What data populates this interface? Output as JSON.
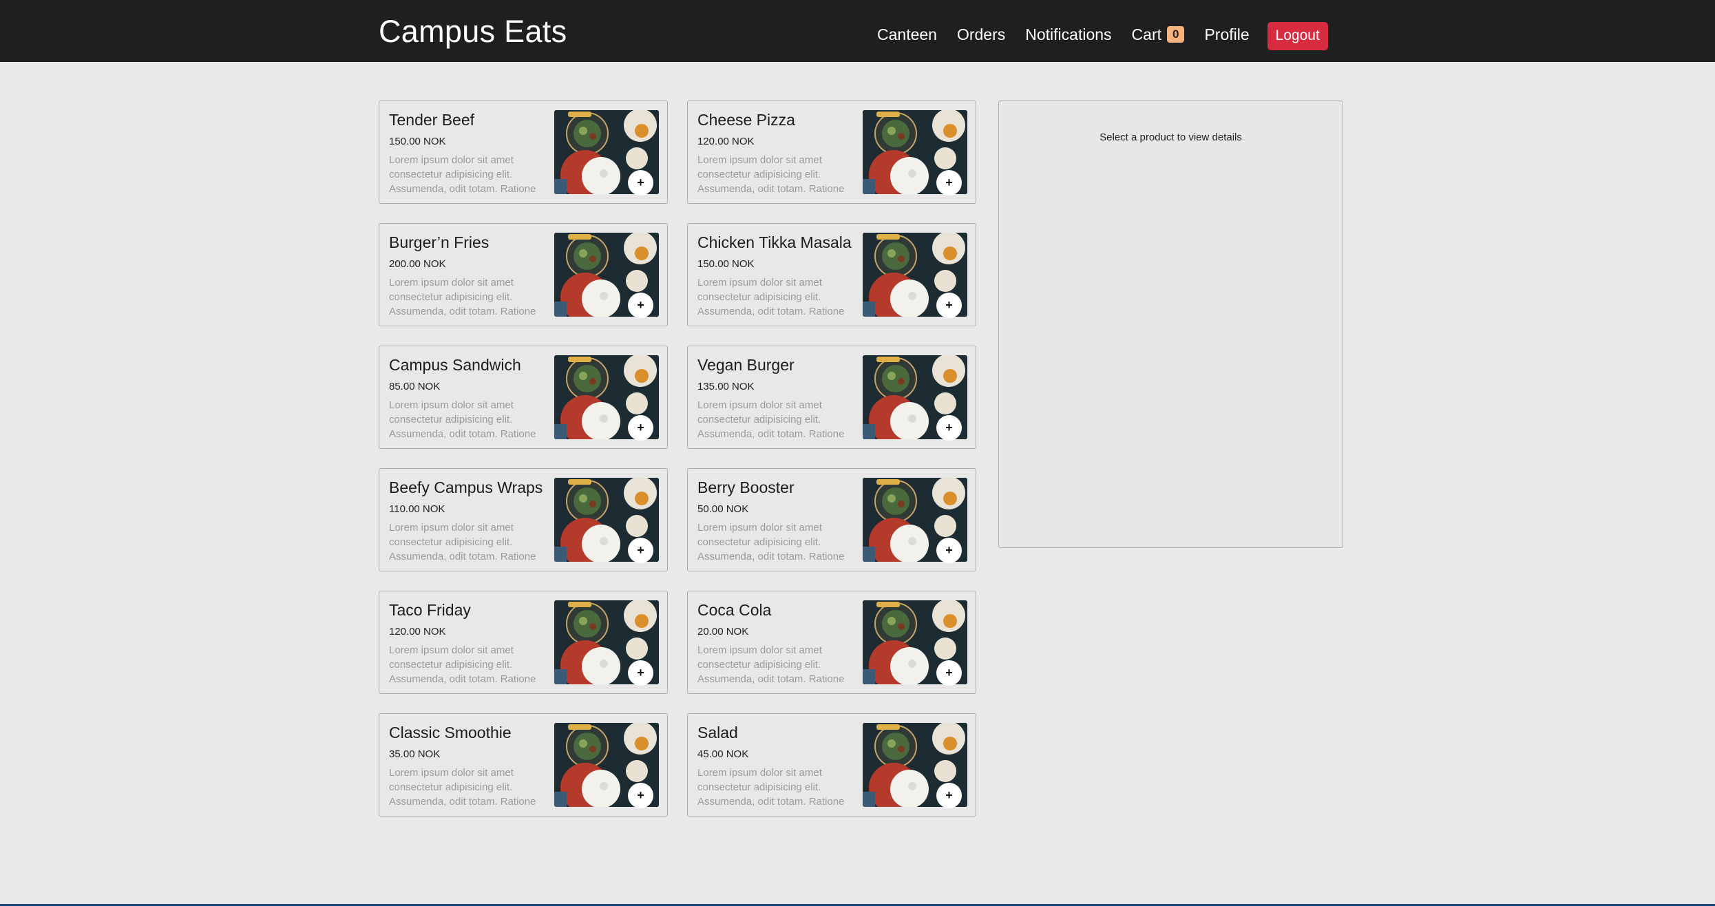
{
  "app": {
    "title": "Campus Eats"
  },
  "nav": {
    "links": [
      "Canteen",
      "Orders",
      "Notifications",
      "Cart",
      "Profile"
    ],
    "cart_count": "0",
    "logout_label": "Logout"
  },
  "products": [
    {
      "name": "Tender Beef",
      "price": "150.00 NOK",
      "description": "Lorem ipsum dolor sit amet consectetur adipisicing elit. Assumenda, odit totam. Ratione",
      "add_label": "+"
    },
    {
      "name": "Cheese Pizza",
      "price": "120.00 NOK",
      "description": "Lorem ipsum dolor sit amet consectetur adipisicing elit. Assumenda, odit totam. Ratione",
      "add_label": "+"
    },
    {
      "name": "Burger’n Fries",
      "price": "200.00 NOK",
      "description": "Lorem ipsum dolor sit amet consectetur adipisicing elit. Assumenda, odit totam. Ratione",
      "add_label": "+"
    },
    {
      "name": "Chicken Tikka Masala",
      "price": "150.00 NOK",
      "description": "Lorem ipsum dolor sit amet consectetur adipisicing elit. Assumenda, odit totam. Ratione",
      "add_label": "+"
    },
    {
      "name": "Campus Sandwich",
      "price": "85.00 NOK",
      "description": "Lorem ipsum dolor sit amet consectetur adipisicing elit. Assumenda, odit totam. Ratione",
      "add_label": "+"
    },
    {
      "name": "Vegan Burger",
      "price": "135.00 NOK",
      "description": "Lorem ipsum dolor sit amet consectetur adipisicing elit. Assumenda, odit totam. Ratione",
      "add_label": "+"
    },
    {
      "name": "Beefy Campus Wraps",
      "price": "110.00 NOK",
      "description": "Lorem ipsum dolor sit amet consectetur adipisicing elit. Assumenda, odit totam. Ratione",
      "add_label": "+"
    },
    {
      "name": "Berry Booster",
      "price": "50.00 NOK",
      "description": "Lorem ipsum dolor sit amet consectetur adipisicing elit. Assumenda, odit totam. Ratione",
      "add_label": "+"
    },
    {
      "name": "Taco Friday",
      "price": "120.00 NOK",
      "description": "Lorem ipsum dolor sit amet consectetur adipisicing elit. Assumenda, odit totam. Ratione",
      "add_label": "+"
    },
    {
      "name": "Coca Cola",
      "price": "20.00 NOK",
      "description": "Lorem ipsum dolor sit amet consectetur adipisicing elit. Assumenda, odit totam. Ratione",
      "add_label": "+"
    },
    {
      "name": "Classic Smoothie",
      "price": "35.00 NOK",
      "description": "Lorem ipsum dolor sit amet consectetur adipisicing elit. Assumenda, odit totam. Ratione",
      "add_label": "+"
    },
    {
      "name": "Salad",
      "price": "45.00 NOK",
      "description": "Lorem ipsum dolor sit amet consectetur adipisicing elit. Assumenda, odit totam. Ratione",
      "add_label": "+"
    }
  ],
  "detail": {
    "placeholder": "Select a product to view details"
  },
  "colors": {
    "navbar": "#1f1f22",
    "logout": "#d72c40",
    "cart_badge": "#f7b37b",
    "background": "#e9e9e9"
  }
}
